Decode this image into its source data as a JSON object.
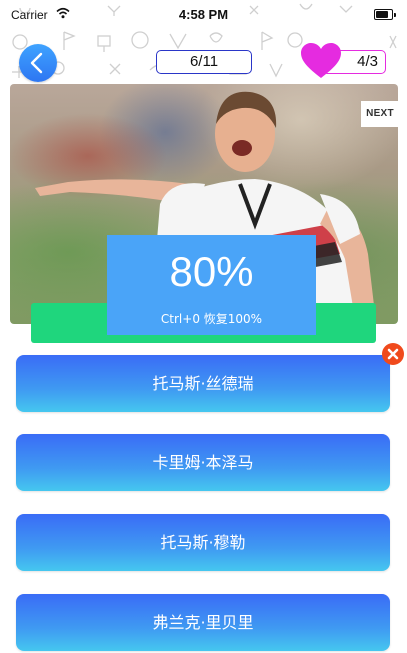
{
  "status_bar": {
    "carrier": "Carrier",
    "time": "4:58 PM"
  },
  "header": {
    "progress": "6/11",
    "lives": "4/3"
  },
  "photo": {
    "next_label": "NEXT"
  },
  "zoom": {
    "percent": "80%",
    "hint": "Ctrl+0 恢复100%"
  },
  "answers": [
    "托马斯·丝德瑞",
    "卡里姆·本泽马",
    "托马斯·穆勒",
    "弗兰克·里贝里"
  ],
  "colors": {
    "accent_blue": "#3a6cf6",
    "answer_bottom": "#45c7ef",
    "heart": "#e52be0",
    "progress_border": "#2a36c8",
    "zoom_bg": "#4aa4f8",
    "green_bar": "#1fd67d",
    "close": "#f04a1c"
  },
  "icons": {
    "back": "chevron-left-icon",
    "lives": "heart-icon",
    "dismiss": "close-icon",
    "wifi": "wifi-icon",
    "battery": "battery-icon"
  }
}
